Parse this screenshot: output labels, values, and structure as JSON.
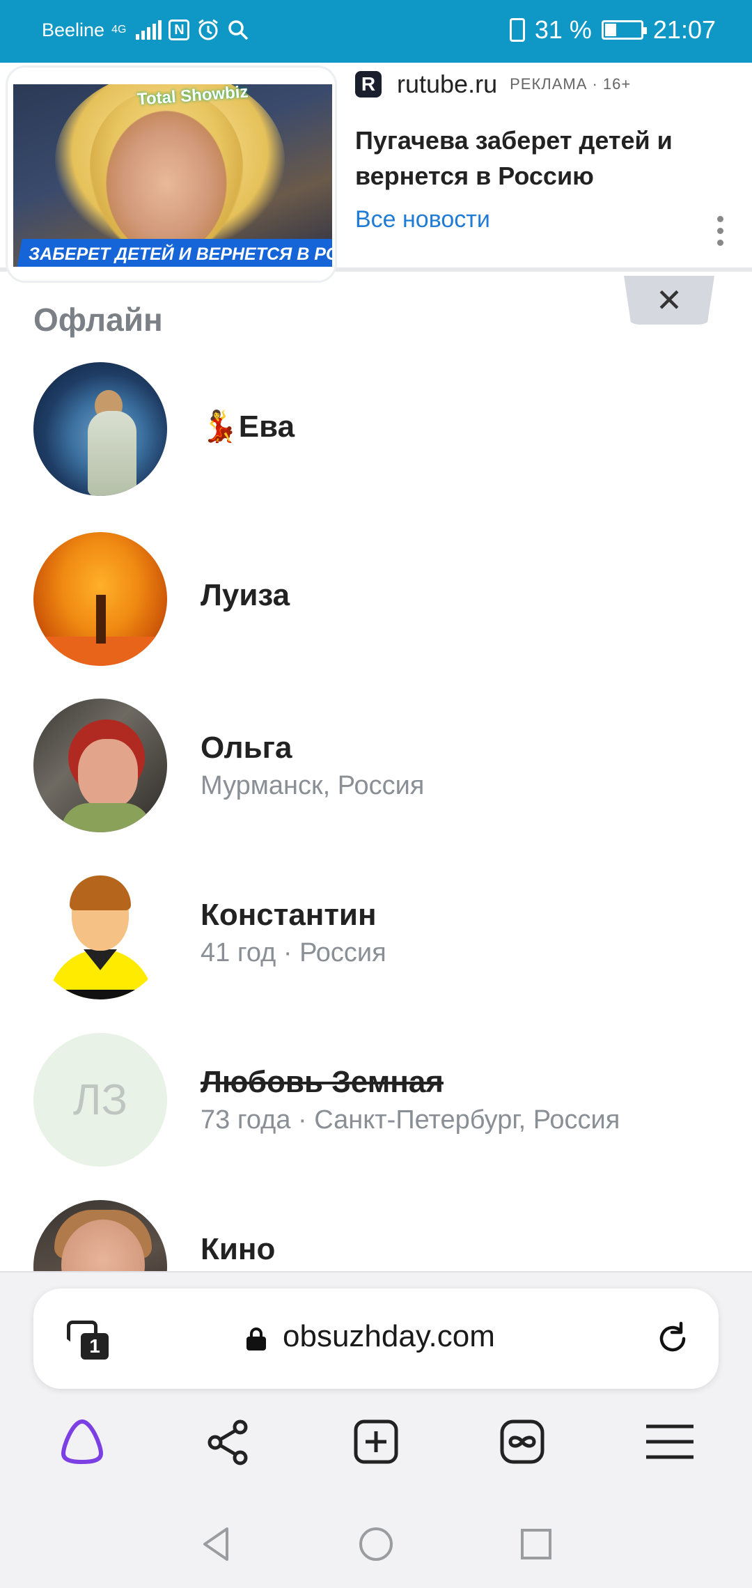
{
  "status_bar": {
    "carrier": "Beeline",
    "network": "4G",
    "battery_text": "31 %",
    "time": "21:07",
    "background_color": "#0f98c6"
  },
  "ad": {
    "image_logo": "Total Showbiz",
    "image_caption": "ЗАБЕРЕТ ДЕТЕЙ И ВЕРНЕТСЯ В РОССИЮ",
    "source_logo_letter": "R",
    "domain": "rutube.ru",
    "tag": "РЕКЛАМА · 16+",
    "title": "Пугачева заберет детей и вернется в Россию",
    "link_text": "Все новости",
    "close_symbol": "✕"
  },
  "section_title": "Офлайн",
  "contacts": [
    {
      "name": "💃Ева",
      "subtitle": "",
      "avatar": "photo",
      "strike": false
    },
    {
      "name": "Луиза",
      "subtitle": "",
      "avatar": "photo",
      "strike": false
    },
    {
      "name": "Ольга",
      "subtitle": "Мурманск, Россия",
      "avatar": "photo",
      "strike": false
    },
    {
      "name": "Константин",
      "subtitle": "41 год · Россия",
      "avatar": "default-male",
      "strike": false
    },
    {
      "name": "Любовь Земная",
      "subtitle": "73 года · Санкт-Петербург, Россия",
      "avatar_initials": "ЛЗ",
      "strike": true
    },
    {
      "name": "Кино",
      "subtitle": "",
      "avatar": "photo",
      "strike": false
    }
  ],
  "browser": {
    "tab_count": "1",
    "url": "obsuzhday.com",
    "toolbar_icons": [
      "alice-icon",
      "share-icon",
      "new-tab-icon",
      "infinity-icon",
      "menu-icon"
    ],
    "accent_color": "#7b3fe4"
  },
  "nav_bar": {
    "icons": [
      "back-icon",
      "home-icon",
      "recents-icon"
    ]
  }
}
